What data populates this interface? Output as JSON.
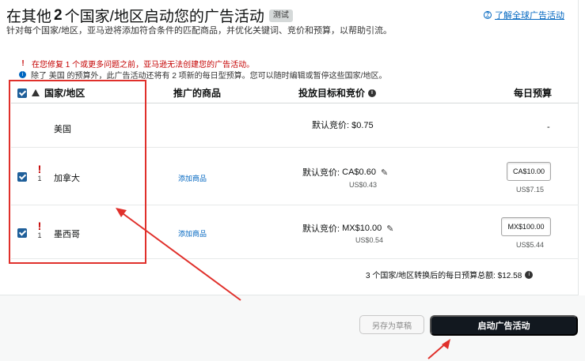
{
  "header": {
    "title_prefix": "在其他",
    "title_count": "2",
    "title_suffix": "个国家/地区启动您的广告活动",
    "badge": "测试",
    "subtitle": "针对每个国家/地区，亚马逊将添加符合条件的匹配商品，并优化关键词、竞价和预算，以帮助引流。",
    "help_link": "了解全球广告活动"
  },
  "notices": {
    "error": "在您修复 1 个或更多问题之前，亚马逊无法创建您的广告活动。",
    "info": "除了 美国 的预算外，此广告活动还将有 2 项新的每日型预算。您可以随时编辑或暂停这些国家/地区。"
  },
  "table": {
    "headers": {
      "country": "国家/地区",
      "products": "推广的商品",
      "bid": "投放目标和竞价",
      "budget": "每日预算"
    },
    "rows": [
      {
        "country": "美国",
        "bid": "默认竞价: $0.75",
        "budget": "-"
      },
      {
        "country": "加拿大",
        "issues": "1",
        "add_products": "添加商品",
        "bid_label": "默认竞价:",
        "bid_value": "CA$0.60",
        "usd": "US$0.43",
        "budget_input": "CA$10.00",
        "budget_usd": "US$7.15"
      },
      {
        "country": "墨西哥",
        "issues": "1",
        "add_products": "添加商品",
        "bid_label": "默认竞价:",
        "bid_value": "MX$10.00",
        "usd": "US$0.54",
        "budget_input": "MX$100.00",
        "budget_usd": "US$5.44"
      }
    ],
    "total": "3 个国家/地区转换后的每日预算总额: $12.58"
  },
  "footer": {
    "draft_button": "另存为草稿",
    "launch_button": "启动广告活动"
  },
  "colors": {
    "accent": "#0066c0",
    "error": "#c40000",
    "annotation": "#e0302b",
    "checkbox": "#1f5f9a",
    "launch_button": "#12181f"
  }
}
